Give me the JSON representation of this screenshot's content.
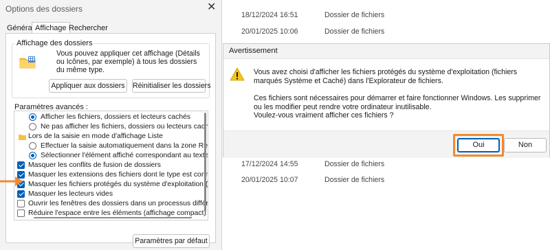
{
  "folder_options": {
    "title": "Options des dossiers",
    "close_glyph": "✕",
    "tabs": [
      "Général",
      "Affichage",
      "Rechercher"
    ],
    "folder_view": {
      "legend": "Affichage des dossiers",
      "description": "Vous pouvez appliquer cet affichage (Détails ou Icônes, par exemple) à tous les dossiers du même type.",
      "apply_button": "Appliquer aux dossiers",
      "reset_button": "Réinitialiser les dossiers"
    },
    "advanced_label": "Paramètres avancés :",
    "advanced_items": [
      {
        "type": "radio",
        "checked": true,
        "label": "Afficher les fichiers, dossiers et lecteurs cachés"
      },
      {
        "type": "radio",
        "checked": false,
        "label": "Ne pas afficher les fichiers, dossiers ou lecteurs cach"
      },
      {
        "type": "folder",
        "label": "Lors de la saisie en mode d'affichage Liste"
      },
      {
        "type": "radio",
        "checked": false,
        "label": "Effectuer la saisie automatiquement dans la zone Rec"
      },
      {
        "type": "radio",
        "checked": true,
        "label": "Sélectionner l'élément affiché correspondant au texte"
      },
      {
        "type": "check",
        "checked": true,
        "label": "Masquer les conflits de fusion de dossiers"
      },
      {
        "type": "check",
        "checked": true,
        "label": "Masquer les extensions des fichiers dont le type est conn"
      },
      {
        "type": "check",
        "checked": true,
        "label": "Masquer les fichiers protégés du système d'exploitation (re"
      },
      {
        "type": "check",
        "checked": true,
        "label": "Masquer les lecteurs vides"
      },
      {
        "type": "check",
        "checked": false,
        "label": "Ouvrir les fenêtres des dossiers dans un processus différe"
      },
      {
        "type": "check",
        "checked": false,
        "label": "Réduire l'espace entre les éléments (affichage compact)"
      }
    ],
    "default_button": "Paramètres par défaut"
  },
  "explorer_rows": [
    {
      "date": "18/12/2024 16:51",
      "type": "Dossier de fichiers"
    },
    {
      "date": "20/01/2025 10:06",
      "type": "Dossier de fichiers"
    },
    {
      "date": "17/12/2024 14:55",
      "type": "Dossier de fichiers"
    },
    {
      "date": "20/01/2025 10:07",
      "type": "Dossier de fichiers"
    }
  ],
  "warning_dialog": {
    "title": "Avertissement",
    "icon": "warning-icon",
    "message_1": "Vous avez choisi d'afficher les fichiers protégés du système d'exploitation (fichiers marqués Système et Caché) dans l'Explorateur de fichiers.",
    "message_2": "Ces fichiers sont nécessaires pour démarrer et faire fonctionner Windows. Les supprimer ou les modifier peut rendre votre ordinateur inutilisable.",
    "message_3": "Voulez-vous vraiment afficher ces fichiers ?",
    "yes_button": "Oui",
    "no_button": "Non"
  },
  "colors": {
    "accent": "#005fb8",
    "highlight": "#f28a2e",
    "warning_yellow": "#f5c518"
  }
}
